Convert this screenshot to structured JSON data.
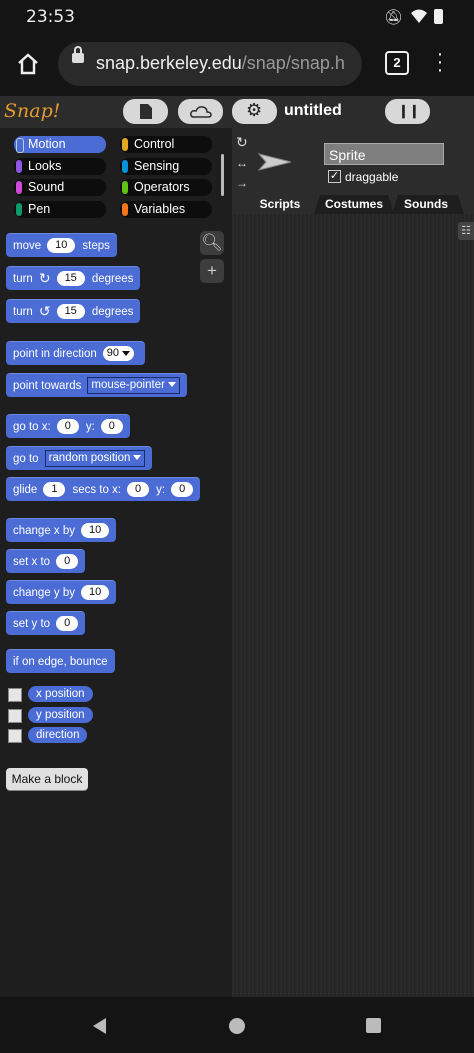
{
  "status": {
    "time": "23:53"
  },
  "browser": {
    "url_host": "snap.berkeley.edu",
    "url_path": "/snap/snap.h",
    "tab_count": "2"
  },
  "snap": {
    "logo": "Snap!",
    "project_title": "untitled",
    "categories": [
      "Motion",
      "Looks",
      "Sound",
      "Pen",
      "Control",
      "Sensing",
      "Operators",
      "Variables"
    ],
    "category_colors": {
      "Motion": "#4a6cd4",
      "Looks": "#8f56e3",
      "Sound": "#cf4ad9",
      "Pen": "#0e9a6c",
      "Control": "#e6a822",
      "Sensing": "#0494dc",
      "Operators": "#62c213",
      "Variables": "#f3761d"
    },
    "blocks": {
      "move": {
        "a": "move",
        "v": "10",
        "b": "steps"
      },
      "turn_cw": {
        "a": "turn",
        "v": "15",
        "b": "degrees"
      },
      "turn_ccw": {
        "a": "turn",
        "v": "15",
        "b": "degrees"
      },
      "point_dir": {
        "a": "point in direction",
        "v": "90"
      },
      "point_towards": {
        "a": "point towards",
        "v": "mouse-pointer"
      },
      "goto_xy": {
        "a": "go to x:",
        "x": "0",
        "b": "y:",
        "y": "0"
      },
      "goto": {
        "a": "go to",
        "v": "random position"
      },
      "glide": {
        "a": "glide",
        "s": "1",
        "b": "secs to x:",
        "x": "0",
        "c": "y:",
        "y": "0"
      },
      "change_x": {
        "a": "change x by",
        "v": "10"
      },
      "set_x": {
        "a": "set x to",
        "v": "0"
      },
      "change_y": {
        "a": "change y by",
        "v": "10"
      },
      "set_y": {
        "a": "set y to",
        "v": "0"
      },
      "bounce": {
        "a": "if on edge, bounce"
      }
    },
    "reporters": [
      "x position",
      "y position",
      "direction"
    ],
    "make_block": "Make a block",
    "sprite_name": "Sprite",
    "draggable_label": "draggable",
    "tabs": [
      "Scripts",
      "Costumes",
      "Sounds"
    ]
  }
}
